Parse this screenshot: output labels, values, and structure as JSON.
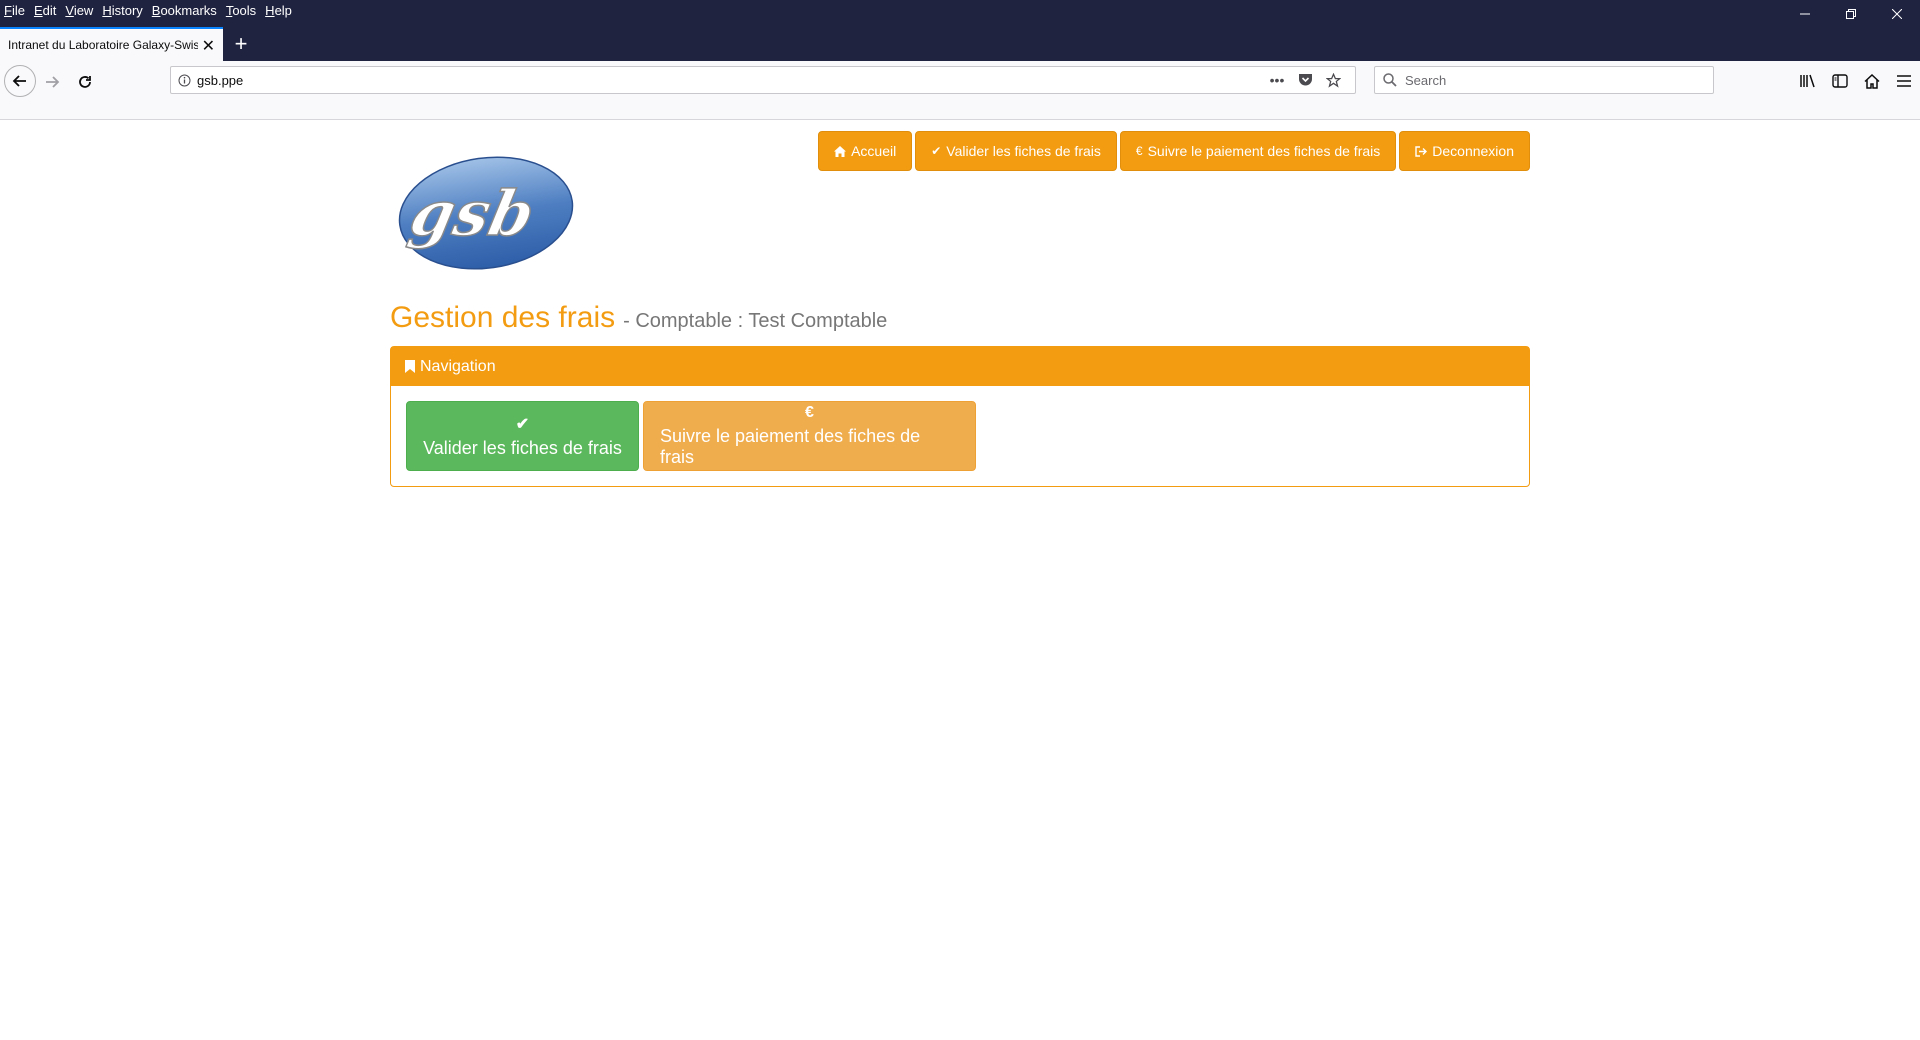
{
  "browser": {
    "menu": [
      "File",
      "Edit",
      "View",
      "History",
      "Bookmarks",
      "Tools",
      "Help"
    ],
    "tab_title": "Intranet du Laboratoire Galaxy-Swiss",
    "url": "gsb.ppe",
    "search_placeholder": "Search",
    "icons": {
      "back": "back-arrow-icon",
      "forward": "forward-arrow-icon",
      "reload": "reload-icon",
      "library": "library-icon",
      "sidebar": "sidebar-icon",
      "home": "home-icon",
      "menu": "hamburger-menu-icon"
    }
  },
  "page": {
    "logo_text": "gsb",
    "top_nav": {
      "accueil": "Accueil",
      "valider": "Valider les fiches de frais",
      "suivre": "Suivre le paiement des fiches de frais",
      "deconnexion": "Deconnexion"
    },
    "title": "Gestion des frais",
    "subtitle": "- Comptable : Test Comptable",
    "panel": {
      "heading": "Navigation",
      "btn_valider": "Valider les fiches de frais",
      "btn_suivre": "Suivre le paiement des fiches de frais"
    },
    "colors": {
      "primary_orange": "#f39c12",
      "success_green": "#5cb85c",
      "warning_orange": "#f0ad4e",
      "chrome_dark": "#202340"
    }
  }
}
